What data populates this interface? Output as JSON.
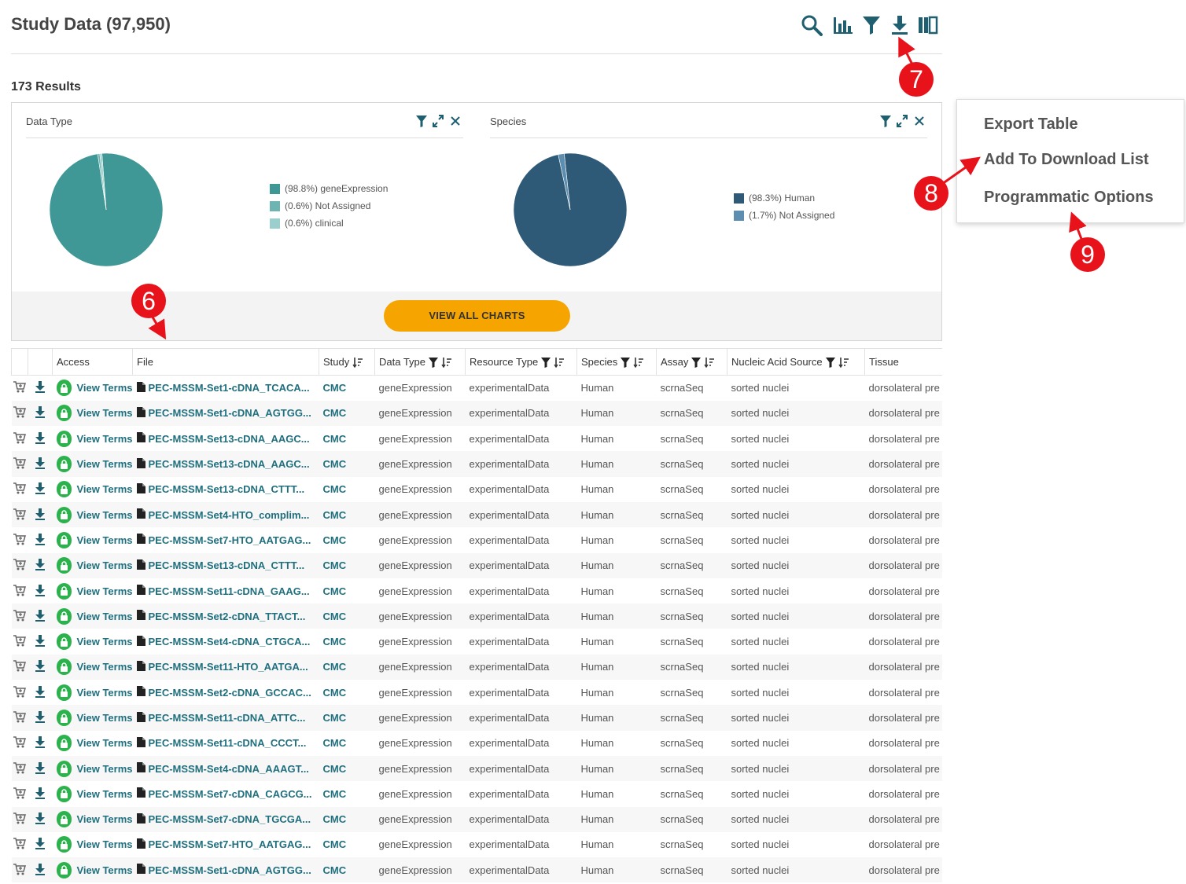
{
  "header": {
    "title": "Study Data (97,950)",
    "results_count": "173 Results"
  },
  "toolbar": {
    "icons": [
      "search-icon",
      "bar-chart-icon",
      "filter-icon",
      "download-icon",
      "columns-icon"
    ]
  },
  "charts": [
    {
      "title": "Data Type",
      "legend": [
        "(98.8%) geneExpression",
        "(0.6%) Not Assigned",
        "(0.6%) clinical"
      ]
    },
    {
      "title": "Species",
      "legend": [
        "(98.3%) Human",
        "(1.7%) Not Assigned"
      ]
    }
  ],
  "chart_data": [
    {
      "type": "pie",
      "title": "Data Type",
      "labels": [
        "geneExpression",
        "Not Assigned",
        "clinical"
      ],
      "values": [
        98.8,
        0.6,
        0.6
      ],
      "colors": [
        "#3f9896",
        "#6db4b2",
        "#9acfcd"
      ]
    },
    {
      "type": "pie",
      "title": "Species",
      "labels": [
        "Human",
        "Not Assigned"
      ],
      "values": [
        98.3,
        1.7
      ],
      "colors": [
        "#2e5a78",
        "#5d8eb0"
      ]
    }
  ],
  "view_all_charts": "VIEW ALL CHARTS",
  "table": {
    "headers": {
      "access": "Access",
      "file": "File",
      "study": "Study",
      "data_type": "Data Type",
      "resource_type": "Resource Type",
      "species": "Species",
      "assay": "Assay",
      "nucleic_acid_source": "Nucleic Acid Source",
      "tissue": "Tissue"
    },
    "rows": [
      {
        "access": "View Terms",
        "file": "PEC-MSSM-Set1-cDNA_TCACA...",
        "study": "CMC",
        "data_type": "geneExpression",
        "resource_type": "experimentalData",
        "species": "Human",
        "assay": "scrnaSeq",
        "nucleic_acid_source": "sorted nuclei",
        "tissue": "dorsolateral pre"
      },
      {
        "access": "View Terms",
        "file": "PEC-MSSM-Set1-cDNA_AGTGG...",
        "study": "CMC",
        "data_type": "geneExpression",
        "resource_type": "experimentalData",
        "species": "Human",
        "assay": "scrnaSeq",
        "nucleic_acid_source": "sorted nuclei",
        "tissue": "dorsolateral pre"
      },
      {
        "access": "View Terms",
        "file": "PEC-MSSM-Set13-cDNA_AAGC...",
        "study": "CMC",
        "data_type": "geneExpression",
        "resource_type": "experimentalData",
        "species": "Human",
        "assay": "scrnaSeq",
        "nucleic_acid_source": "sorted nuclei",
        "tissue": "dorsolateral pre"
      },
      {
        "access": "View Terms",
        "file": "PEC-MSSM-Set13-cDNA_AAGC...",
        "study": "CMC",
        "data_type": "geneExpression",
        "resource_type": "experimentalData",
        "species": "Human",
        "assay": "scrnaSeq",
        "nucleic_acid_source": "sorted nuclei",
        "tissue": "dorsolateral pre"
      },
      {
        "access": "View Terms",
        "file": "PEC-MSSM-Set13-cDNA_CTTT...",
        "study": "CMC",
        "data_type": "geneExpression",
        "resource_type": "experimentalData",
        "species": "Human",
        "assay": "scrnaSeq",
        "nucleic_acid_source": "sorted nuclei",
        "tissue": "dorsolateral pre"
      },
      {
        "access": "View Terms",
        "file": "PEC-MSSM-Set4-HTO_complim...",
        "study": "CMC",
        "data_type": "geneExpression",
        "resource_type": "experimentalData",
        "species": "Human",
        "assay": "scrnaSeq",
        "nucleic_acid_source": "sorted nuclei",
        "tissue": "dorsolateral pre"
      },
      {
        "access": "View Terms",
        "file": "PEC-MSSM-Set7-HTO_AATGAG...",
        "study": "CMC",
        "data_type": "geneExpression",
        "resource_type": "experimentalData",
        "species": "Human",
        "assay": "scrnaSeq",
        "nucleic_acid_source": "sorted nuclei",
        "tissue": "dorsolateral pre"
      },
      {
        "access": "View Terms",
        "file": "PEC-MSSM-Set13-cDNA_CTTT...",
        "study": "CMC",
        "data_type": "geneExpression",
        "resource_type": "experimentalData",
        "species": "Human",
        "assay": "scrnaSeq",
        "nucleic_acid_source": "sorted nuclei",
        "tissue": "dorsolateral pre"
      },
      {
        "access": "View Terms",
        "file": "PEC-MSSM-Set11-cDNA_GAAG...",
        "study": "CMC",
        "data_type": "geneExpression",
        "resource_type": "experimentalData",
        "species": "Human",
        "assay": "scrnaSeq",
        "nucleic_acid_source": "sorted nuclei",
        "tissue": "dorsolateral pre"
      },
      {
        "access": "View Terms",
        "file": "PEC-MSSM-Set2-cDNA_TTACT...",
        "study": "CMC",
        "data_type": "geneExpression",
        "resource_type": "experimentalData",
        "species": "Human",
        "assay": "scrnaSeq",
        "nucleic_acid_source": "sorted nuclei",
        "tissue": "dorsolateral pre"
      },
      {
        "access": "View Terms",
        "file": "PEC-MSSM-Set4-cDNA_CTGCA...",
        "study": "CMC",
        "data_type": "geneExpression",
        "resource_type": "experimentalData",
        "species": "Human",
        "assay": "scrnaSeq",
        "nucleic_acid_source": "sorted nuclei",
        "tissue": "dorsolateral pre"
      },
      {
        "access": "View Terms",
        "file": "PEC-MSSM-Set11-HTO_AATGA...",
        "study": "CMC",
        "data_type": "geneExpression",
        "resource_type": "experimentalData",
        "species": "Human",
        "assay": "scrnaSeq",
        "nucleic_acid_source": "sorted nuclei",
        "tissue": "dorsolateral pre"
      },
      {
        "access": "View Terms",
        "file": "PEC-MSSM-Set2-cDNA_GCCAC...",
        "study": "CMC",
        "data_type": "geneExpression",
        "resource_type": "experimentalData",
        "species": "Human",
        "assay": "scrnaSeq",
        "nucleic_acid_source": "sorted nuclei",
        "tissue": "dorsolateral pre"
      },
      {
        "access": "View Terms",
        "file": "PEC-MSSM-Set11-cDNA_ATTC...",
        "study": "CMC",
        "data_type": "geneExpression",
        "resource_type": "experimentalData",
        "species": "Human",
        "assay": "scrnaSeq",
        "nucleic_acid_source": "sorted nuclei",
        "tissue": "dorsolateral pre"
      },
      {
        "access": "View Terms",
        "file": "PEC-MSSM-Set11-cDNA_CCCT...",
        "study": "CMC",
        "data_type": "geneExpression",
        "resource_type": "experimentalData",
        "species": "Human",
        "assay": "scrnaSeq",
        "nucleic_acid_source": "sorted nuclei",
        "tissue": "dorsolateral pre"
      },
      {
        "access": "View Terms",
        "file": "PEC-MSSM-Set4-cDNA_AAAGT...",
        "study": "CMC",
        "data_type": "geneExpression",
        "resource_type": "experimentalData",
        "species": "Human",
        "assay": "scrnaSeq",
        "nucleic_acid_source": "sorted nuclei",
        "tissue": "dorsolateral pre"
      },
      {
        "access": "View Terms",
        "file": "PEC-MSSM-Set7-cDNA_CAGCG...",
        "study": "CMC",
        "data_type": "geneExpression",
        "resource_type": "experimentalData",
        "species": "Human",
        "assay": "scrnaSeq",
        "nucleic_acid_source": "sorted nuclei",
        "tissue": "dorsolateral pre"
      },
      {
        "access": "View Terms",
        "file": "PEC-MSSM-Set7-cDNA_TGCGA...",
        "study": "CMC",
        "data_type": "geneExpression",
        "resource_type": "experimentalData",
        "species": "Human",
        "assay": "scrnaSeq",
        "nucleic_acid_source": "sorted nuclei",
        "tissue": "dorsolateral pre"
      },
      {
        "access": "View Terms",
        "file": "PEC-MSSM-Set7-HTO_AATGAG...",
        "study": "CMC",
        "data_type": "geneExpression",
        "resource_type": "experimentalData",
        "species": "Human",
        "assay": "scrnaSeq",
        "nucleic_acid_source": "sorted nuclei",
        "tissue": "dorsolateral pre"
      },
      {
        "access": "View Terms",
        "file": "PEC-MSSM-Set1-cDNA_AGTGG...",
        "study": "CMC",
        "data_type": "geneExpression",
        "resource_type": "experimentalData",
        "species": "Human",
        "assay": "scrnaSeq",
        "nucleic_acid_source": "sorted nuclei",
        "tissue": "dorsolateral pre"
      }
    ]
  },
  "download_menu": {
    "items": [
      "Export Table",
      "Add To Download List",
      "Programmatic Options"
    ]
  },
  "callouts": [
    "6",
    "7",
    "8",
    "9"
  ],
  "colors": {
    "accent": "#f5a400",
    "link": "#1f6f7f",
    "lock": "#2bb24c",
    "callout": "#e8121b"
  }
}
